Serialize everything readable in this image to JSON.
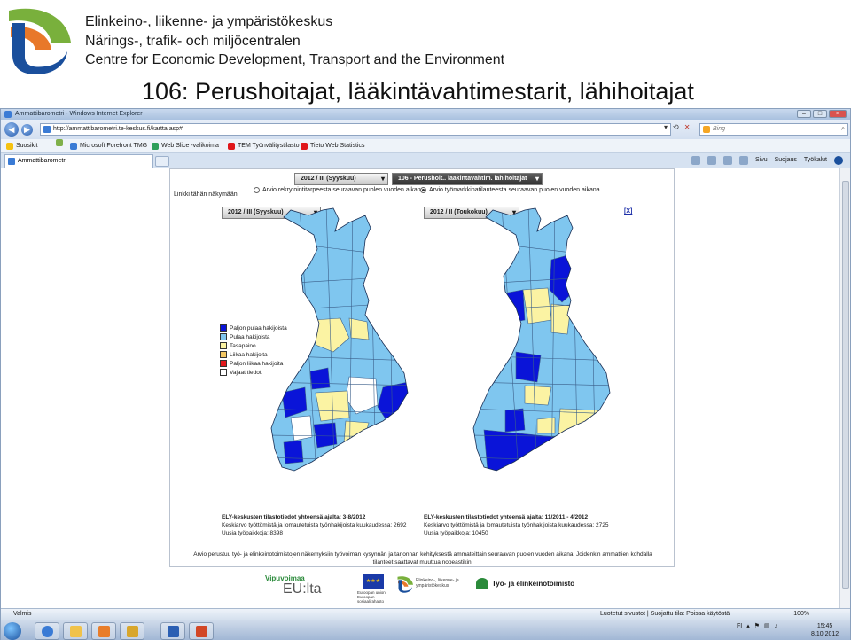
{
  "slide": {
    "org_line1": "Elinkeino-, liikenne- ja ympäristökeskus",
    "org_line2": "Närings-, trafik- och miljöcentralen",
    "org_line3": "Centre for Economic Development, Transport and the Environment",
    "title": "106: Perushoitajat, lääkintävahtimestarit, lähihoitajat"
  },
  "browser": {
    "title": "Ammattibarometri - Windows Internet Explorer",
    "address": "http://ammattibarometri.te-keskus.fi/kartta.asp#",
    "search_placeholder": "Bing",
    "favorites": {
      "label": "Suosikit",
      "items": [
        "Microsoft Forefront TMG",
        "Web Slice -valikoima",
        "TEM Työnvälitystilasto",
        "Tieto Web Statistics"
      ]
    },
    "tab_label": "Ammattibarometri",
    "commands": [
      "Sivu",
      "Suojaus",
      "Työkalut"
    ],
    "status_left": "Valmis",
    "status_zone": "Luotetut sivustot | Suojattu tila: Poissa käytöstä",
    "zoom": "100%",
    "clock_time": "15:45",
    "clock_date": "8.10.2012",
    "lang": "FI"
  },
  "page": {
    "period_top": "2012 / III (Syyskuu)",
    "occupation": "106 - Perushoit.. lääkintävahtim. lähihoitajat",
    "link_label": "Linkki tähän näkymään",
    "radio_1": "Arvio rekrytointitarpeesta seuraavan puolen vuoden aikana",
    "radio_2": "Arvio työmarkkinatilanteesta seuraavan puolen vuoden aikana",
    "close_label": "[X]",
    "left_period": "2012 / III (Syyskuu)",
    "right_period": "2012 / II (Toukokuu)",
    "legend": [
      {
        "label": "Paljon pulaa hakijoista",
        "color": "#0a14d8"
      },
      {
        "label": "Pulaa hakijoista",
        "color": "#7fc6ef"
      },
      {
        "label": "Tasapaino",
        "color": "#fbf3a3"
      },
      {
        "label": "Liikaa hakijoita",
        "color": "#f3c763"
      },
      {
        "label": "Paljon liikaa hakijoita",
        "color": "#e0171b"
      },
      {
        "label": "Vajaat tiedot",
        "color": "#ffffff"
      }
    ],
    "left_stats": {
      "heading": "ELY-keskusten tilastotiedot yhteensä ajalta: 3-8/2012",
      "line1": "Keskiarvo työttömistä ja lomautetuista työnhakijoista kuukaudessa: 2692",
      "line2": "Uusia työpaikkoja: 8398"
    },
    "right_stats": {
      "heading": "ELY-keskusten tilastotiedot yhteensä ajalta: 11/2011 - 4/2012",
      "line1": "Keskiarvo työttömistä ja lomautetuista työnhakijoista kuukaudessa: 2725",
      "line2": "Uusia työpaikkoja: 10450"
    },
    "note_line1": "Arvio perustuu työ- ja elinkeinotoimistojen näkemyksiin työvoiman kysynnän ja tarjonnan kehityksestä ammateittain seuraavan puolen vuoden aikana. Joidenkin ammattien kohdalla",
    "note_line2": "tilanteet saattavat muuttua nopeastikin.",
    "footer": {
      "vipuvoimaa": "Vipuvoimaa",
      "eu_lta": "EU:lta",
      "eu_small": "Euroopan unioni Euroopan sosiaalirahasto",
      "ely_small": "Elinkeino-, liikenne- ja ympäristökeskus",
      "te": "Työ- ja elinkeinotoimisto"
    }
  }
}
